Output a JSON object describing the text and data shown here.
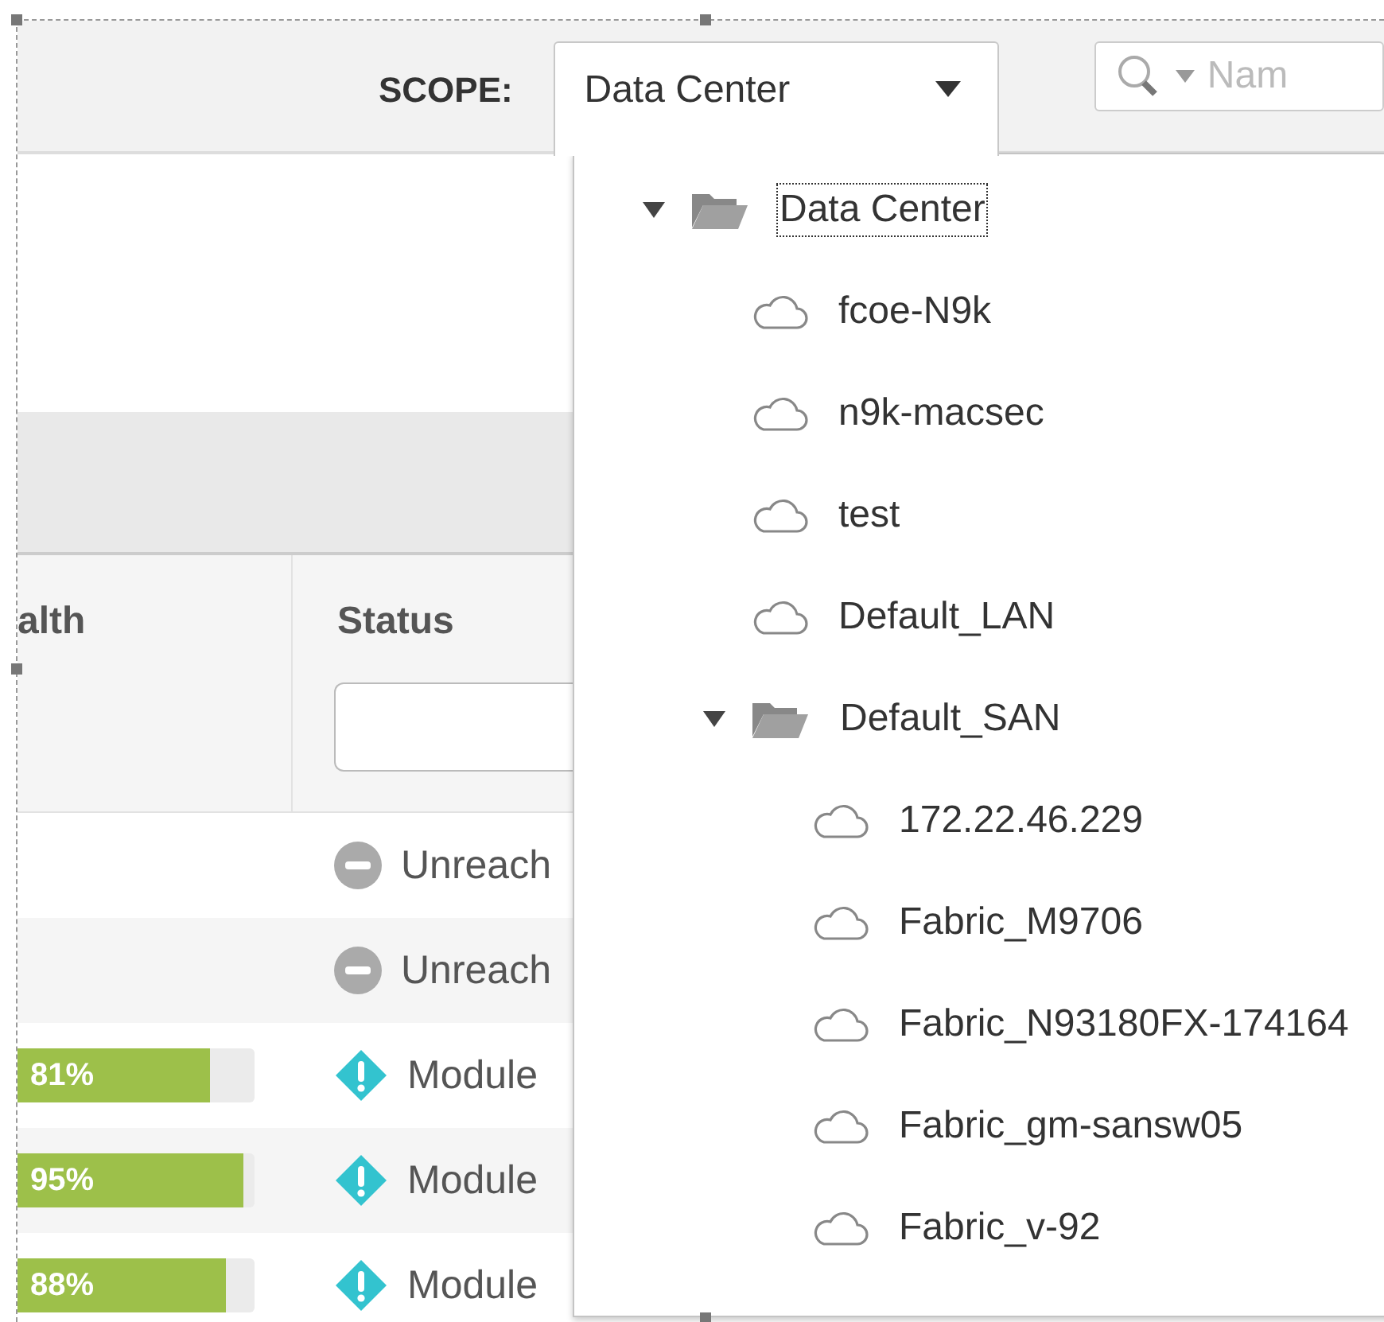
{
  "scope": {
    "label": "SCOPE:",
    "value": "Data Center",
    "open": true
  },
  "search": {
    "placeholder": "Nam"
  },
  "table": {
    "columns": [
      {
        "label": "alth"
      },
      {
        "label": "Status",
        "filter": true
      }
    ],
    "rows": [
      {
        "kind": "unreachable",
        "status": "Unreach"
      },
      {
        "kind": "unreachable",
        "status": "Unreach"
      },
      {
        "health": {
          "level": 0.81,
          "text": "81%"
        },
        "kind": "warning",
        "status": "Module"
      },
      {
        "health": {
          "level": 0.95,
          "text": "95%"
        },
        "kind": "warning",
        "status": "Module"
      },
      {
        "health": {
          "level": 0.88,
          "text": "88%"
        },
        "kind": "warning",
        "status": "Module"
      }
    ]
  },
  "tree": [
    {
      "label": "Data Center",
      "kind": "folder",
      "expanded": true,
      "focused": true,
      "children": [
        {
          "label": "fcoe-N9k",
          "kind": "fabric"
        },
        {
          "label": "n9k-macsec",
          "kind": "fabric"
        },
        {
          "label": "test",
          "kind": "fabric"
        },
        {
          "label": "Default_LAN",
          "kind": "fabric"
        },
        {
          "label": "Default_SAN",
          "kind": "folder",
          "expanded": true,
          "focused": false,
          "children": [
            {
              "label": "172.22.46.229",
              "kind": "fabric"
            },
            {
              "label": "Fabric_M9706",
              "kind": "fabric"
            },
            {
              "label": "Fabric_N93180FX-174164",
              "kind": "fabric"
            },
            {
              "label": "Fabric_gm-sansw05",
              "kind": "fabric"
            },
            {
              "label": "Fabric_v-92",
              "kind": "fabric"
            }
          ]
        }
      ]
    }
  ]
}
